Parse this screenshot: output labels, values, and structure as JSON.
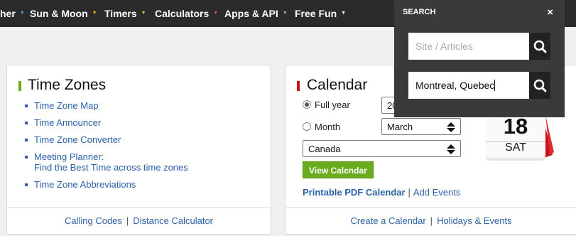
{
  "nav": {
    "items": [
      {
        "label": "her"
      },
      {
        "label": "Sun & Moon"
      },
      {
        "label": "Timers"
      },
      {
        "label": "Calculators"
      },
      {
        "label": "Apps & API"
      },
      {
        "label": "Free Fun"
      }
    ]
  },
  "timezones": {
    "title": "Time Zones",
    "accent": "#6bab1e",
    "links": [
      {
        "label": "Time Zone Map"
      },
      {
        "label": "Time Announcer"
      },
      {
        "label": "Time Zone Converter"
      },
      {
        "label": "Meeting Planner:",
        "sub": "Find the Best Time across time zones"
      },
      {
        "label": "Time Zone Abbreviations"
      }
    ],
    "footer": {
      "left": "Calling Codes",
      "sep": "|",
      "right": "Distance Calculator"
    }
  },
  "calendar": {
    "title": "Calendar",
    "accent": "#cc1111",
    "full_year_label": "Full year",
    "year_value": "20",
    "month_label": "Month",
    "month_value": "March",
    "country_value": "Canada",
    "view_button": "View Calendar",
    "printable": "Printable PDF Calendar",
    "links_sep": "|",
    "add_events": "Add Events",
    "footer": {
      "left": "Create a Calendar",
      "sep": "|",
      "right": "Holidays & Events"
    },
    "badge_day": "18",
    "badge_weekday": "SAT"
  },
  "search": {
    "heading": "SEARCH",
    "close": "×",
    "site_placeholder": "Site / Articles",
    "location_value": "Montreal, Quebec"
  }
}
